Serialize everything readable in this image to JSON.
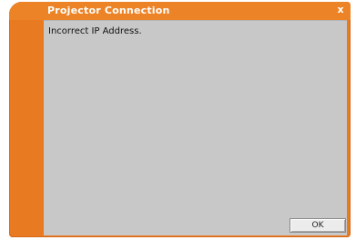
{
  "window": {
    "title": "Projector Connection",
    "close_label": "x"
  },
  "dialog": {
    "message": "Incorrect IP Address.",
    "ok_label": "OK"
  },
  "colors": {
    "frame": "#e87a22",
    "content_bg": "#c8c8c8"
  }
}
